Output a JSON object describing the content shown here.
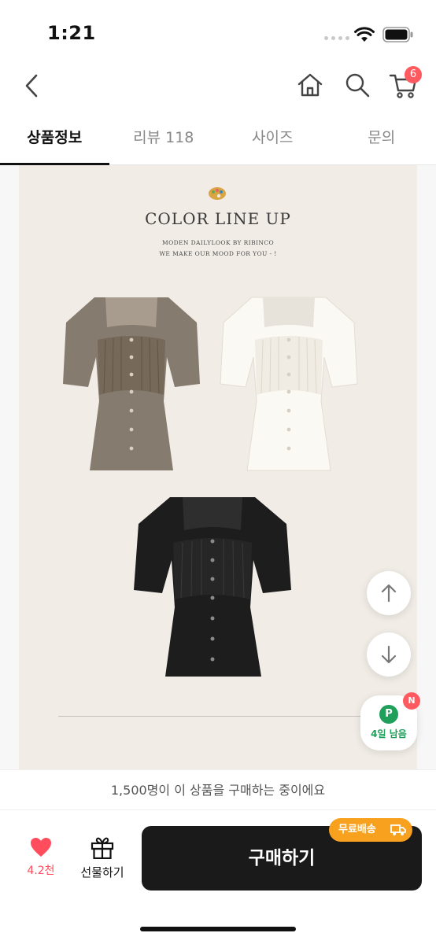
{
  "status_bar": {
    "time": "1:21",
    "icons": [
      "signal-dots-icon",
      "wifi-icon",
      "battery-icon"
    ]
  },
  "top_nav": {
    "icons": [
      "back-icon",
      "home-icon",
      "search-icon",
      "cart-icon"
    ],
    "cart_count": "6"
  },
  "tabs": [
    {
      "label": "상품정보",
      "active": true
    },
    {
      "label": "리뷰 118",
      "active": false
    },
    {
      "label": "사이즈",
      "active": false
    },
    {
      "label": "문의",
      "active": false
    }
  ],
  "product_image": {
    "title": "COLOR LINE UP",
    "subtitle_line1": "MODEN DAILYLOOK BY RIBINCO",
    "subtitle_line2": "WE MAKE OUR MOOD FOR YOU - !",
    "items": [
      "beige-blouse",
      "white-blouse",
      "black-blouse"
    ]
  },
  "floating": {
    "icons": [
      "arrow-up-icon",
      "arrow-down-icon"
    ],
    "points_letter": "P",
    "points_text": "4일 남음",
    "new_badge": "N"
  },
  "notice": {
    "text": "1,500명이 이 상품을 구매하는 중이에요"
  },
  "actions": {
    "like_count": "4.2천",
    "gift_label": "선물하기",
    "buy_label": "구매하기",
    "free_shipping": "무료배송"
  },
  "colors": {
    "accent_red": "#ff4d5d",
    "buy_button": "#1a1a1a",
    "shipping_badge": "#f7a11f",
    "points_green": "#1fa05a",
    "image_bg": "#f1ece6"
  }
}
